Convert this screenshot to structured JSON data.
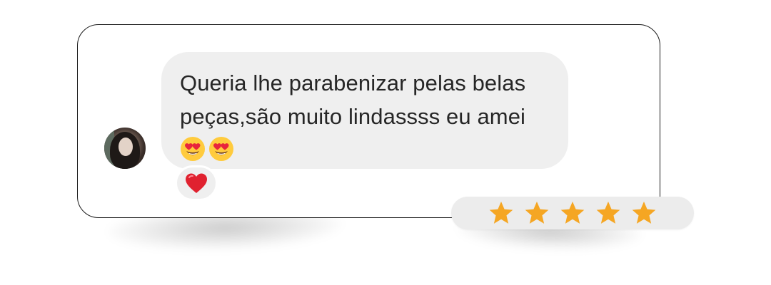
{
  "comment": {
    "message": "Queria lhe parabenizar pelas belas peças,são muito lindassss eu amei",
    "emojis": [
      {
        "icon": "smiling-face-with-heart-eyes-icon"
      },
      {
        "icon": "smiling-face-with-heart-eyes-icon"
      }
    ],
    "reaction_icon": "red-heart-icon"
  },
  "rating": {
    "stars": 5,
    "max": 5,
    "star_color": "#f5a623"
  },
  "colors": {
    "bubble": "#efefef",
    "text": "#262626",
    "heart": "#e0212f"
  }
}
